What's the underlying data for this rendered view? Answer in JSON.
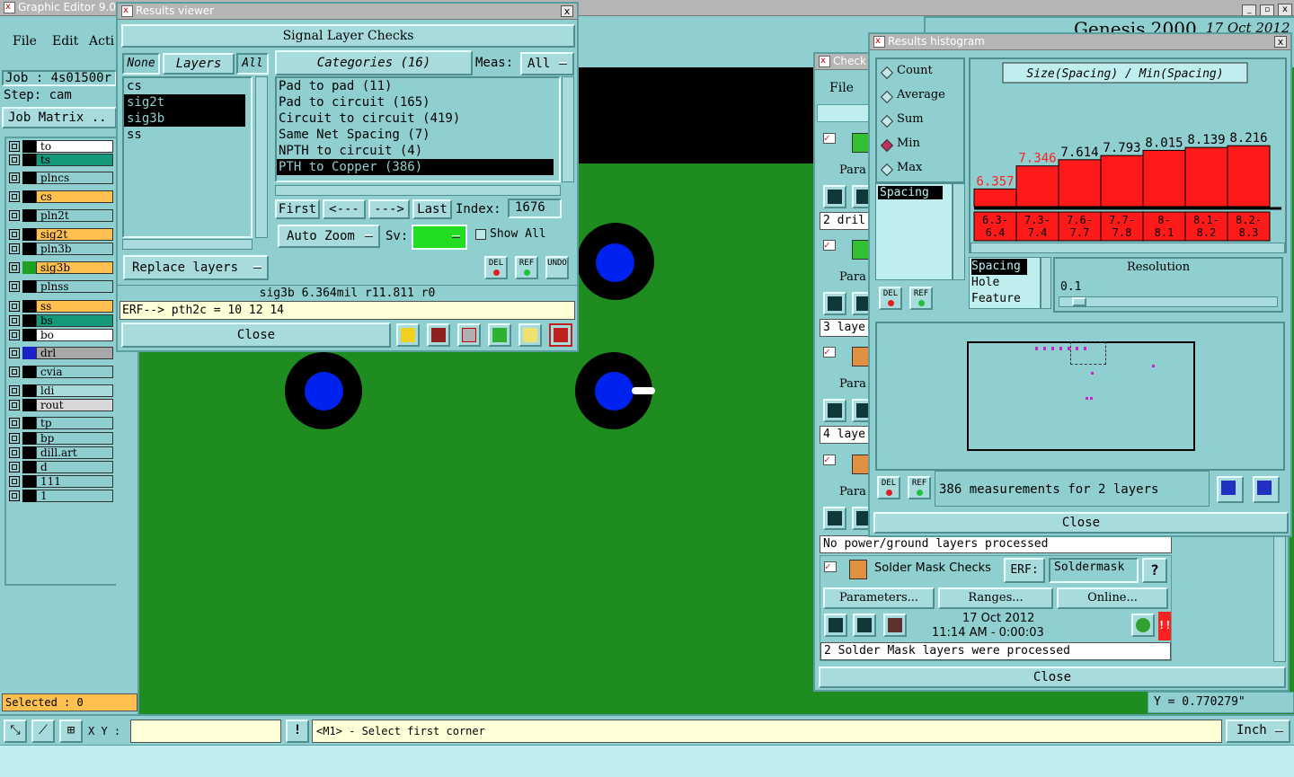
{
  "app": {
    "title": "Graphic Editor 9.02",
    "menu": [
      "File",
      "Edit",
      "Acti"
    ],
    "banner": "Genesis 2000",
    "banner_date": "17 Oct 2012"
  },
  "left_panel": {
    "job_label": "Job : 4s01500r",
    "step_label": "Step: cam",
    "job_matrix_button": "Job Matrix ..",
    "selected_text": "Selected : 0",
    "layers": [
      {
        "name": "to",
        "color": "#ffffff",
        "swatch": "#000000"
      },
      {
        "name": "ts",
        "color": "#14997a",
        "swatch": "#000000"
      },
      {
        "name": "plncs",
        "color": "#8fcfcf",
        "swatch": "#000000"
      },
      {
        "name": "cs",
        "color": "#ffc050",
        "swatch": "#000000"
      },
      {
        "name": "pln2t",
        "color": "#8fcfcf",
        "swatch": "#000000"
      },
      {
        "name": "sig2t",
        "color": "#ffc050",
        "swatch": "#000000"
      },
      {
        "name": "pln3b",
        "color": "#8fcfcf",
        "swatch": "#000000"
      },
      {
        "name": "sig3b",
        "color": "#ffc050",
        "swatch": "#20a020"
      },
      {
        "name": "plnss",
        "color": "#8fcfcf",
        "swatch": "#000000"
      },
      {
        "name": "ss",
        "color": "#ffc050",
        "swatch": "#000000"
      },
      {
        "name": "bs",
        "color": "#14997a",
        "swatch": "#000000"
      },
      {
        "name": "bo",
        "color": "#ffffff",
        "swatch": "#000000"
      },
      {
        "name": "drl",
        "color": "#a8a8a8",
        "swatch": "#1a22c8"
      },
      {
        "name": "cvia",
        "color": "#8fcfcf",
        "swatch": "#000000"
      },
      {
        "name": "ldi",
        "color": "#a8dcdc",
        "swatch": "#000000"
      },
      {
        "name": "rout",
        "color": "#d8d8d8",
        "swatch": "#000000"
      },
      {
        "name": "tp",
        "color": "#8fcfcf",
        "swatch": "#000000"
      },
      {
        "name": "bp",
        "color": "#8fcfcf",
        "swatch": "#000000"
      },
      {
        "name": "dill.art",
        "color": "#8fcfcf",
        "swatch": "#000000"
      },
      {
        "name": "d",
        "color": "#8fcfcf",
        "swatch": "#000000"
      },
      {
        "name": "111",
        "color": "#8fcfcf",
        "swatch": "#000000"
      },
      {
        "name": "1",
        "color": "#8fcfcf",
        "swatch": "#000000"
      }
    ]
  },
  "status_bar": {
    "xy_label": "X Y :",
    "xy_value": "",
    "hint": "<M1> - Select first corner",
    "units": "Inch",
    "y_readout": "Y = 0.770279\""
  },
  "results_viewer": {
    "title": "Results viewer",
    "heading": "Signal Layer Checks",
    "none_btn": "None",
    "layers_btn": "Layers",
    "all_btn": "All",
    "categories_btn": "Categories (16)",
    "meas_label": "Meas:",
    "meas_value": "All",
    "layers": [
      "cs",
      "sig2t",
      "sig3b",
      "ss"
    ],
    "selected_layers": [
      "sig2t",
      "sig3b"
    ],
    "categories": [
      "Pad to pad (11)",
      "Pad to circuit (165)",
      "Circuit to circuit (419)",
      "Same Net Spacing (7)",
      "NPTH to circuit (4)",
      "PTH to Copper (386)"
    ],
    "selected_category": "PTH to Copper (386)",
    "first_btn": "First",
    "prev_btn": "<---",
    "next_btn": "--->",
    "last_btn": "Last",
    "index_label": "Index:",
    "index_value": "1676",
    "auto_zoom": "Auto Zoom",
    "sv_label": "Sv:",
    "show_all": "Show All",
    "replace_layers": "Replace layers",
    "del_label": "DEL",
    "ref_label": "REF",
    "undo_label": "UNDO",
    "measure_info": "sig3b 6.364mil  r11.811  r0",
    "erf_text": "ERF--> pth2c = 10 12 14",
    "close": "Close"
  },
  "checklist": {
    "title": "Check",
    "file_menu": "File",
    "params_label": "Para",
    "rows": [
      "2 dril",
      "3 laye",
      "4 laye"
    ],
    "no_power_text": "No power/ground layers processed",
    "solder_mask": "Solder Mask Checks",
    "erf_label": "ERF:",
    "erf_value": "Soldermask",
    "help_btn": "?",
    "parameters_btn": "Parameters...",
    "ranges_btn": "Ranges...",
    "online_btn": "Online...",
    "date": "17 Oct 2012",
    "time": "11:14 AM - 0:00:03",
    "processed_text": "2 Solder Mask layers were processed",
    "close": "Close"
  },
  "histogram": {
    "title": "Results histogram",
    "modes": [
      "Count",
      "Average",
      "Sum",
      "Min",
      "Max"
    ],
    "selected_mode": "Min",
    "formula": "Size(Spacing) / Min(Spacing)",
    "list_items": [
      "Spacing"
    ],
    "sel_items": [
      "Spacing",
      "Hole",
      "Feature"
    ],
    "resolution_label": "Resolution",
    "resolution_value": "0.1",
    "summary": "386 measurements for 2 layers",
    "del_label": "DEL",
    "ref_label": "REF",
    "close": "Close"
  },
  "chart_data": {
    "type": "bar",
    "title": "Size(Spacing) / Min(Spacing)",
    "categories": [
      "6.3-6.4",
      "7.3-7.4",
      "7.6-7.7",
      "7.7-7.8",
      "8-8.1",
      "8.1-8.2",
      "8.2-8.3"
    ],
    "category_lines": [
      [
        "6.3-",
        "6.4"
      ],
      [
        "7.3-",
        "7.4"
      ],
      [
        "7.6-",
        "7.7"
      ],
      [
        "7.7-",
        "7.8"
      ],
      [
        "8-",
        "8.1"
      ],
      [
        "8.1-",
        "8.2"
      ],
      [
        "8.2-",
        "8.3"
      ]
    ],
    "values": [
      6.357,
      7.346,
      7.614,
      7.793,
      8.015,
      8.139,
      8.216
    ],
    "value_labels": [
      "6.357",
      "7.346",
      "7.614",
      "7.793",
      "8.015",
      "8.139",
      "8.216"
    ],
    "highlight_colors": [
      "#ff2020",
      "#ff2020",
      "#000000",
      "#000000",
      "#000000",
      "#000000",
      "#000000"
    ],
    "bar_color": "#ff1a1a"
  }
}
